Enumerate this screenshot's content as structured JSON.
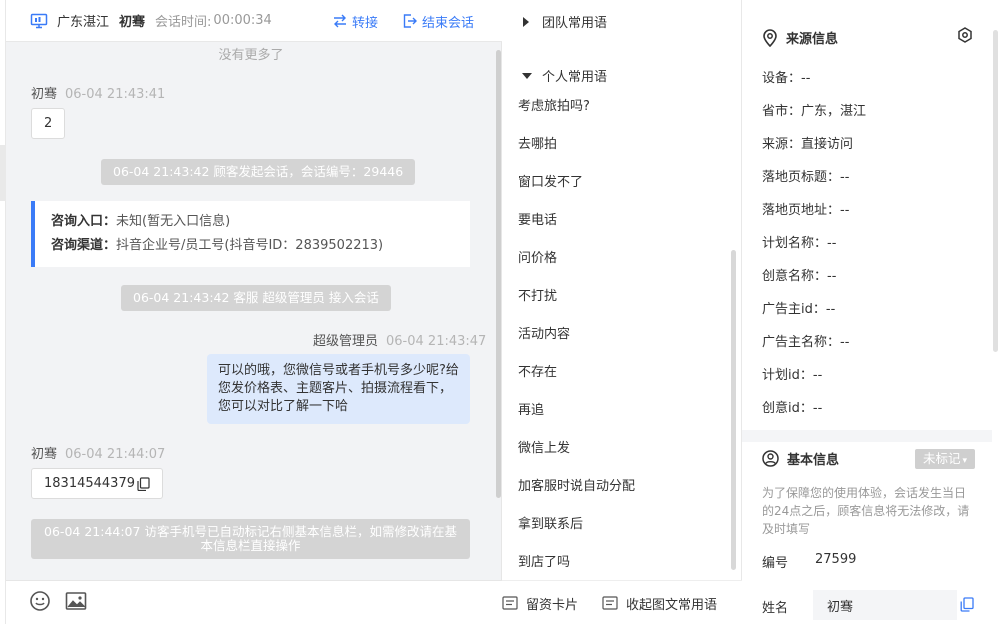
{
  "colors": {
    "accent": "#3a7bf7",
    "chat_bg": "#f2f3f5",
    "out_bubble": "#dde9fc",
    "system_bg": "#d4d4d4"
  },
  "header": {
    "icon": "monitor-icon",
    "location": "广东湛江",
    "visitor_name": "初骞",
    "session_time_label": "会话时间:",
    "session_time": "00:00:34",
    "transfer_label": "转接",
    "end_label": "结束会话"
  },
  "chat": {
    "no_more": "没有更多了",
    "messages": [
      {
        "sender": "初骞",
        "time": "06-04 21:43:41",
        "text": "2"
      },
      {
        "system": "06-04 21:43:42 顾客发起会话，会话编号：29446"
      },
      {
        "card": {
          "entry_label": "咨询入口：",
          "entry_value": "未知(暂无入口信息)",
          "channel_label": "咨询渠道：",
          "channel_value": "抖音企业号/员工号(抖音号ID：2839502213)"
        }
      },
      {
        "system": "06-04 21:43:42 客服 超级管理员 接入会话"
      },
      {
        "sender": "超级管理员",
        "time": "06-04 21:43:47",
        "text": "可以的哦，您微信号或者手机号多少呢?给您发价格表、主题客片、拍摄流程看下，您可以对比了解一下哈"
      },
      {
        "sender": "初骞",
        "time": "06-04 21:44:07",
        "text": "18314544379"
      },
      {
        "system": "06-04 21:44:07 访客手机号已自动标记右侧基本信息栏，如需修改请在基本信息栏直接操作"
      }
    ]
  },
  "toolbar": {
    "emoji_icon": "smiley-icon",
    "image_icon": "image-icon"
  },
  "phrases": {
    "team_group": "团队常用语",
    "personal_group": "个人常用语",
    "items": [
      "考虑旅拍吗?",
      "去哪拍",
      "窗口发不了",
      "要电话",
      "问价格",
      "不打扰",
      "活动内容",
      "不存在",
      "再追",
      "微信上发",
      "加客服时说自动分配",
      "拿到联系后",
      "到店了吗"
    ],
    "footer_card": "留资卡片",
    "footer_collect": "收起图文常用语"
  },
  "panel": {
    "source_title": "来源信息",
    "source_rows": [
      {
        "label": "设备：",
        "value": "--"
      },
      {
        "label": "省市：",
        "value": "广东，湛江"
      },
      {
        "label": "来源：",
        "value": "直接访问"
      },
      {
        "label": "落地页标题：",
        "value": "--"
      },
      {
        "label": "落地页地址：",
        "value": "--"
      },
      {
        "label": "计划名称：",
        "value": "--"
      },
      {
        "label": "创意名称：",
        "value": "--"
      },
      {
        "label": "广告主id：",
        "value": "--"
      },
      {
        "label": "广告主名称：",
        "value": "--"
      },
      {
        "label": "计划id：",
        "value": "--"
      },
      {
        "label": "创意id：",
        "value": "--"
      }
    ],
    "basic_title": "基本信息",
    "basic_badge": "未标记",
    "hint": "为了保障您的使用体验，会话发生当日的24点之后，顾客信息将无法修改，请及时填写",
    "id_label": "编号",
    "id_value": "27599",
    "name_label": "姓名",
    "name_value": "初骞"
  }
}
